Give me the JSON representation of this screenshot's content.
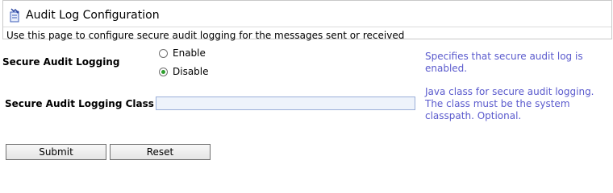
{
  "header": {
    "title": "Audit Log Configuration",
    "description": "Use this page to configure secure audit logging for the messages sent or received"
  },
  "secure_audit_logging": {
    "label": "Secure Audit Logging",
    "options": [
      "Enable",
      "Disable"
    ],
    "selected": "Disable",
    "help": "Specifies that secure audit log is enabled."
  },
  "secure_audit_logging_class": {
    "label": "Secure Audit Logging Class",
    "value": "",
    "help": "Java class for secure audit logging. The class must be the system classpath. Optional."
  },
  "buttons": {
    "submit": "Submit",
    "reset": "Reset"
  }
}
